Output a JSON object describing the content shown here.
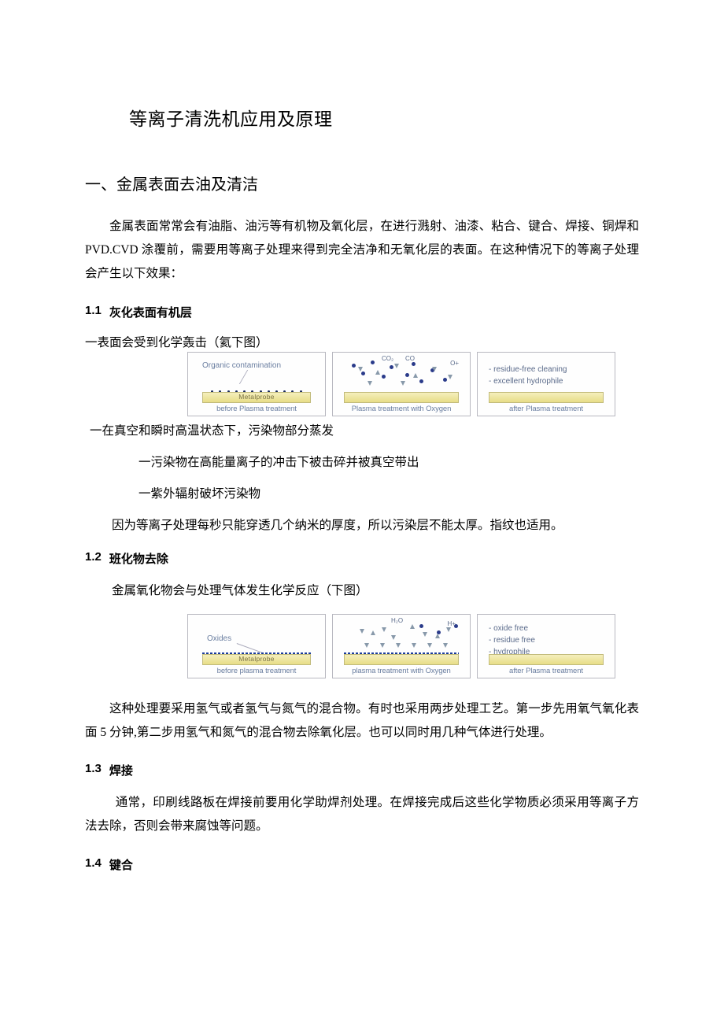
{
  "title": "等离子清洗机应用及原理",
  "section1": {
    "heading": "一、金属表面去油及清洁",
    "intro": "金属表面常常会有油脂、油污等有机物及氧化层，在进行溅射、油漆、粘合、键合、焊接、铜焊和 PVD.CVD 涂覆前，需要用等离子处理来得到完全洁净和无氧化层的表面。在这种情况下的等离子处理会产生以下效果：",
    "s1_1": {
      "num": "1.1",
      "title": "灰化表面有机层",
      "lead": "一表面会受到化学轰击（氦下图）",
      "after_fig": "一在真空和瞬时高温状态下，污染物部分蒸发",
      "item2": "一污染物在高能量离子的冲击下被击碎并被真空带出",
      "item3": "一紫外辐射破坏污染物",
      "note": "因为等离子处理每秒只能穿透几个纳米的厚度，所以污染层不能太厚。指纹也适用。"
    },
    "fig1": {
      "p1": {
        "label": "Organic contamination",
        "bar": "Metalprobe",
        "caption": "before Plasma treatment"
      },
      "p2": {
        "g1": "CO₂",
        "g2": "CO",
        "g3": "O+",
        "caption": "Plasma treatment with Oxygen"
      },
      "p3": {
        "l1": "- residue-free cleaning",
        "l2": "- excellent hydrophile",
        "caption": "after Plasma treatment"
      }
    },
    "s1_2": {
      "num": "1.2",
      "title": "班化物去除",
      "lead": "金属氧化物会与处理气体发生化学反应（下图）",
      "after": "这种处理要采用氢气或者氢气与氮气的混合物。有时也采用两步处理工艺。第一步先用氧气氧化表面 5 分钟,第二步用氢气和氮气的混合物去除氧化层。也可以同时用几种气体进行处理。"
    },
    "fig2": {
      "p1": {
        "label": "Oxides",
        "bar": "Metalprobe",
        "caption": "before plasma treatment"
      },
      "p2": {
        "g1": "H₂O",
        "g2": "H+",
        "caption": "plasma treatment with Oxygen"
      },
      "p3": {
        "l1": "- oxide free",
        "l2": "- residue free",
        "l3": "- hydrophile",
        "caption": "after Plasma treatment"
      }
    },
    "s1_3": {
      "num": "1.3",
      "title": "焊接",
      "body": "通常，印刷线路板在焊接前要用化学助焊剂处理。在焊接完成后这些化学物质必须采用等离子方法去除，否则会带来腐蚀等问题。"
    },
    "s1_4": {
      "num": "1.4",
      "title": "键合"
    }
  }
}
